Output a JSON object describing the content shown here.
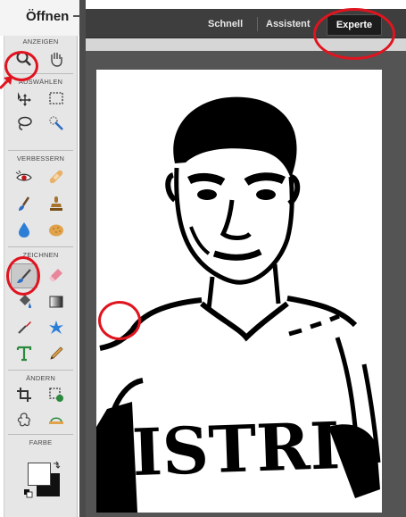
{
  "header": {
    "open_label": "Öffnen"
  },
  "topbar": {
    "modes": [
      "Schnell",
      "Assistent",
      "Experte"
    ],
    "active_mode": "Experte"
  },
  "toolbox": {
    "sections": [
      "ANZEIGEN",
      "AUSWÄHLEN",
      "VERBESSERN",
      "ZEICHNEN",
      "ÄNDERN",
      "FARBE"
    ],
    "tools": {
      "anzeigen": [
        "zoom-icon",
        "hand-icon"
      ],
      "auswaehlen": [
        "move-icon",
        "marquee-icon",
        "lasso-icon",
        "quick-selection-icon"
      ],
      "verbessern": [
        "red-eye-icon",
        "spot-healing-icon",
        "smart-brush-icon",
        "clone-stamp-icon",
        "blur-icon",
        "sponge-icon"
      ],
      "zeichnen": [
        "brush-icon",
        "eraser-icon",
        "paint-bucket-icon",
        "gradient-icon",
        "eyedropper-icon",
        "custom-shape-icon",
        "type-icon",
        "pencil-icon"
      ],
      "aendern": [
        "crop-icon",
        "recompose-icon",
        "content-aware-move-icon",
        "straighten-icon"
      ]
    },
    "selected_tool": "brush-icon",
    "foreground_color": "#ffffff",
    "background_color": "#111111"
  },
  "colors": {
    "annotation": "#e0141f",
    "topbar": "#3e3e3e",
    "workspace": "#545454",
    "toolbox": "#e6e6e6"
  }
}
